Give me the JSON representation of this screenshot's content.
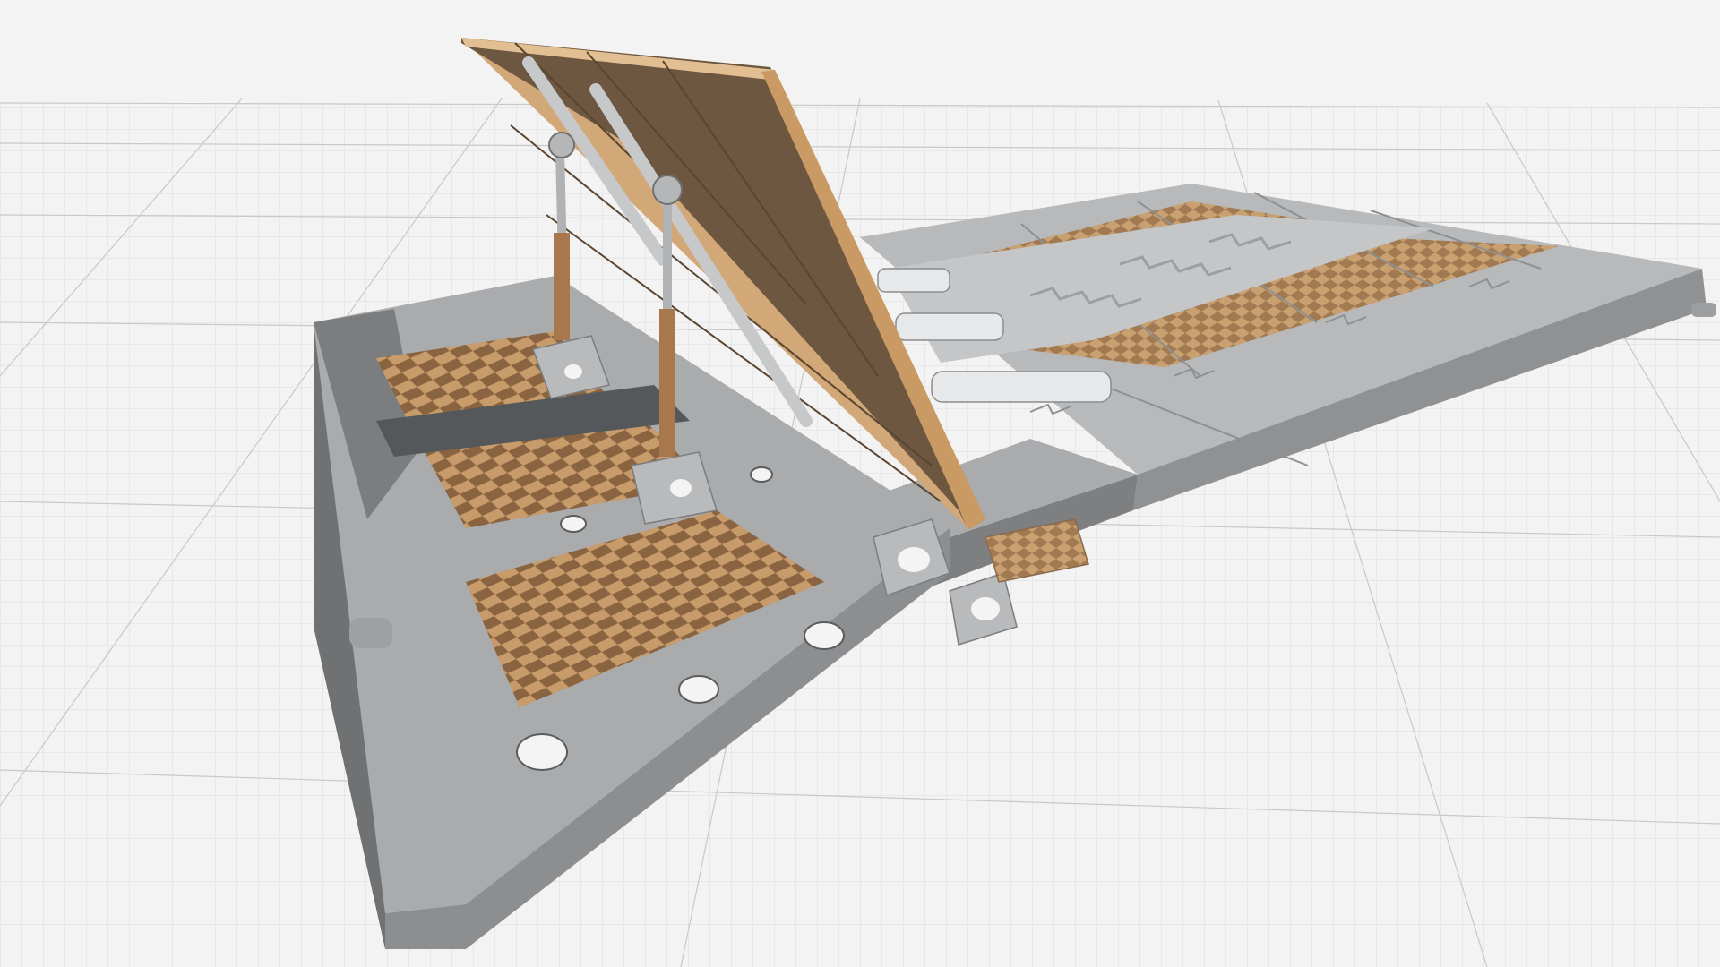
{
  "app": {
    "view": "3d-model-viewport"
  },
  "scene": {
    "grid": true,
    "background_color": "#f3f3f3",
    "grid_color": "#d6d6d6",
    "grid_major_color": "#c4c4c4",
    "model": {
      "description_visible": false,
      "colors": {
        "base_gray": "#9a9c9e",
        "base_top": "#b9bbbd",
        "base_dark": "#6f7173",
        "tread_tan": "#c89b6a",
        "tread_dark": "#8f6a44",
        "panel_tan": "#d2a878",
        "panel_face": "#6e5740",
        "hinge_metal": "#c6c8ca"
      },
      "parts": [
        {
          "name": "raised-ramp-panel",
          "icon": "ramp-panel-icon"
        },
        {
          "name": "hydraulic-strut-left",
          "icon": "strut-icon"
        },
        {
          "name": "hydraulic-strut-right",
          "icon": "strut-icon"
        },
        {
          "name": "base-plate",
          "icon": "base-plate-icon"
        },
        {
          "name": "deck-segments",
          "icon": "deck-icon"
        },
        {
          "name": "track-mechanism",
          "icon": "rail-icon"
        },
        {
          "name": "anti-slip-treads",
          "icon": "tread-icon"
        }
      ]
    }
  }
}
